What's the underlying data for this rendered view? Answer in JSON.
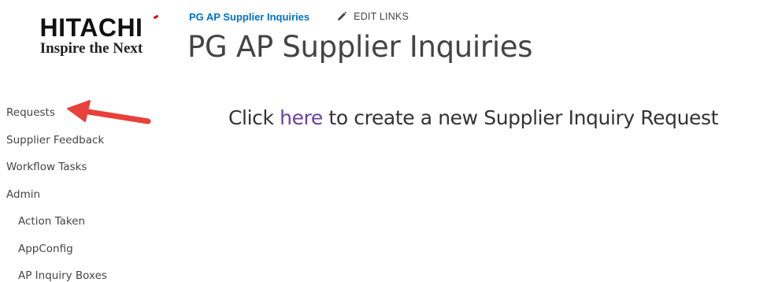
{
  "logo": {
    "name": "HITACHI",
    "tagline": "Inspire the Next"
  },
  "header": {
    "site_link": "PG AP Supplier Inquiries",
    "edit_links_label": "EDIT LINKS",
    "edit_icon": "pencil-icon",
    "page_title": "PG AP Supplier Inquiries"
  },
  "nav": {
    "items": [
      {
        "label": "Requests",
        "level": 0
      },
      {
        "label": "Supplier Feedback",
        "level": 0
      },
      {
        "label": "Workflow Tasks",
        "level": 0
      },
      {
        "label": "Admin",
        "level": 0
      },
      {
        "label": "Action Taken",
        "level": 1
      },
      {
        "label": "AppConfig",
        "level": 1
      },
      {
        "label": "AP Inquiry Boxes",
        "level": 1
      }
    ]
  },
  "annotation": {
    "type": "arrow",
    "color": "#e8403a",
    "points_to": "Requests"
  },
  "main": {
    "prefix": "Click ",
    "link_text": "here",
    "suffix": " to create a new Supplier Inquiry Request"
  },
  "colors": {
    "link_blue": "#0072c6",
    "link_purple": "#6b3fa0",
    "text": "#444444",
    "brand_red": "#cc0000"
  }
}
